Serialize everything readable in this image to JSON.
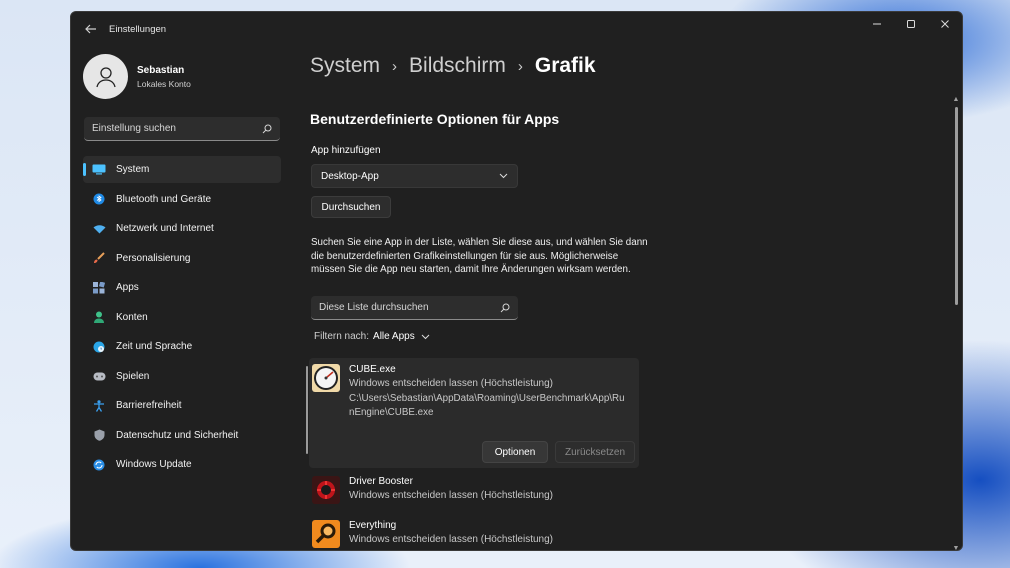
{
  "window": {
    "title": "Einstellungen"
  },
  "titlebar": {
    "minimize": "—",
    "maximize": "☐",
    "close": "✕"
  },
  "profile": {
    "name": "Sebastian",
    "account_type": "Lokales Konto"
  },
  "sidebar": {
    "search_placeholder": "Einstellung suchen",
    "items": [
      {
        "label": "System",
        "icon": "monitor-icon",
        "active": true
      },
      {
        "label": "Bluetooth und Geräte",
        "icon": "bluetooth-icon"
      },
      {
        "label": "Netzwerk und Internet",
        "icon": "wifi-icon"
      },
      {
        "label": "Personalisierung",
        "icon": "brush-icon"
      },
      {
        "label": "Apps",
        "icon": "apps-icon"
      },
      {
        "label": "Konten",
        "icon": "person-icon"
      },
      {
        "label": "Zeit und Sprache",
        "icon": "globe-clock-icon"
      },
      {
        "label": "Spielen",
        "icon": "gamepad-icon"
      },
      {
        "label": "Barrierefreiheit",
        "icon": "accessibility-icon"
      },
      {
        "label": "Datenschutz und Sicherheit",
        "icon": "shield-icon"
      },
      {
        "label": "Windows Update",
        "icon": "update-icon"
      }
    ]
  },
  "breadcrumb": {
    "level1": "System",
    "level2": "Bildschirm",
    "current": "Grafik",
    "separator": "›"
  },
  "main": {
    "section_title": "Benutzerdefinierte Optionen für Apps",
    "add_app_label": "App hinzufügen",
    "add_app_selected": "Desktop-App",
    "browse_button": "Durchsuchen",
    "description": "Suchen Sie eine App in der Liste, wählen Sie diese aus, und wählen Sie dann die benutzerdefinierten Grafikeinstellungen für sie aus. Möglicherweise müssen Sie die App neu starten, damit Ihre Änderungen wirksam werden.",
    "list_search_placeholder": "Diese Liste durchsuchen",
    "filter_label": "Filtern nach:",
    "filter_value": "Alle Apps"
  },
  "apps": [
    {
      "name": "CUBE.exe",
      "status": "Windows entscheiden lassen (Höchstleistung)",
      "path": "C:\\Users\\Sebastian\\AppData\\Roaming\\UserBenchmark\\App\\RunEngine\\CUBE.exe",
      "options_button": "Optionen",
      "reset_button": "Zurücksetzen",
      "icon": "gauge-icon"
    },
    {
      "name": "Driver Booster",
      "status": "Windows entscheiden lassen (Höchstleistung)",
      "icon": "driver-booster-icon"
    },
    {
      "name": "Everything",
      "status": "Windows entscheiden lassen (Höchstleistung)",
      "icon": "magnifier-icon"
    }
  ],
  "colors": {
    "accent": "#4cc2ff",
    "window_bg": "#202020",
    "card_bg": "#2b2b2b"
  }
}
